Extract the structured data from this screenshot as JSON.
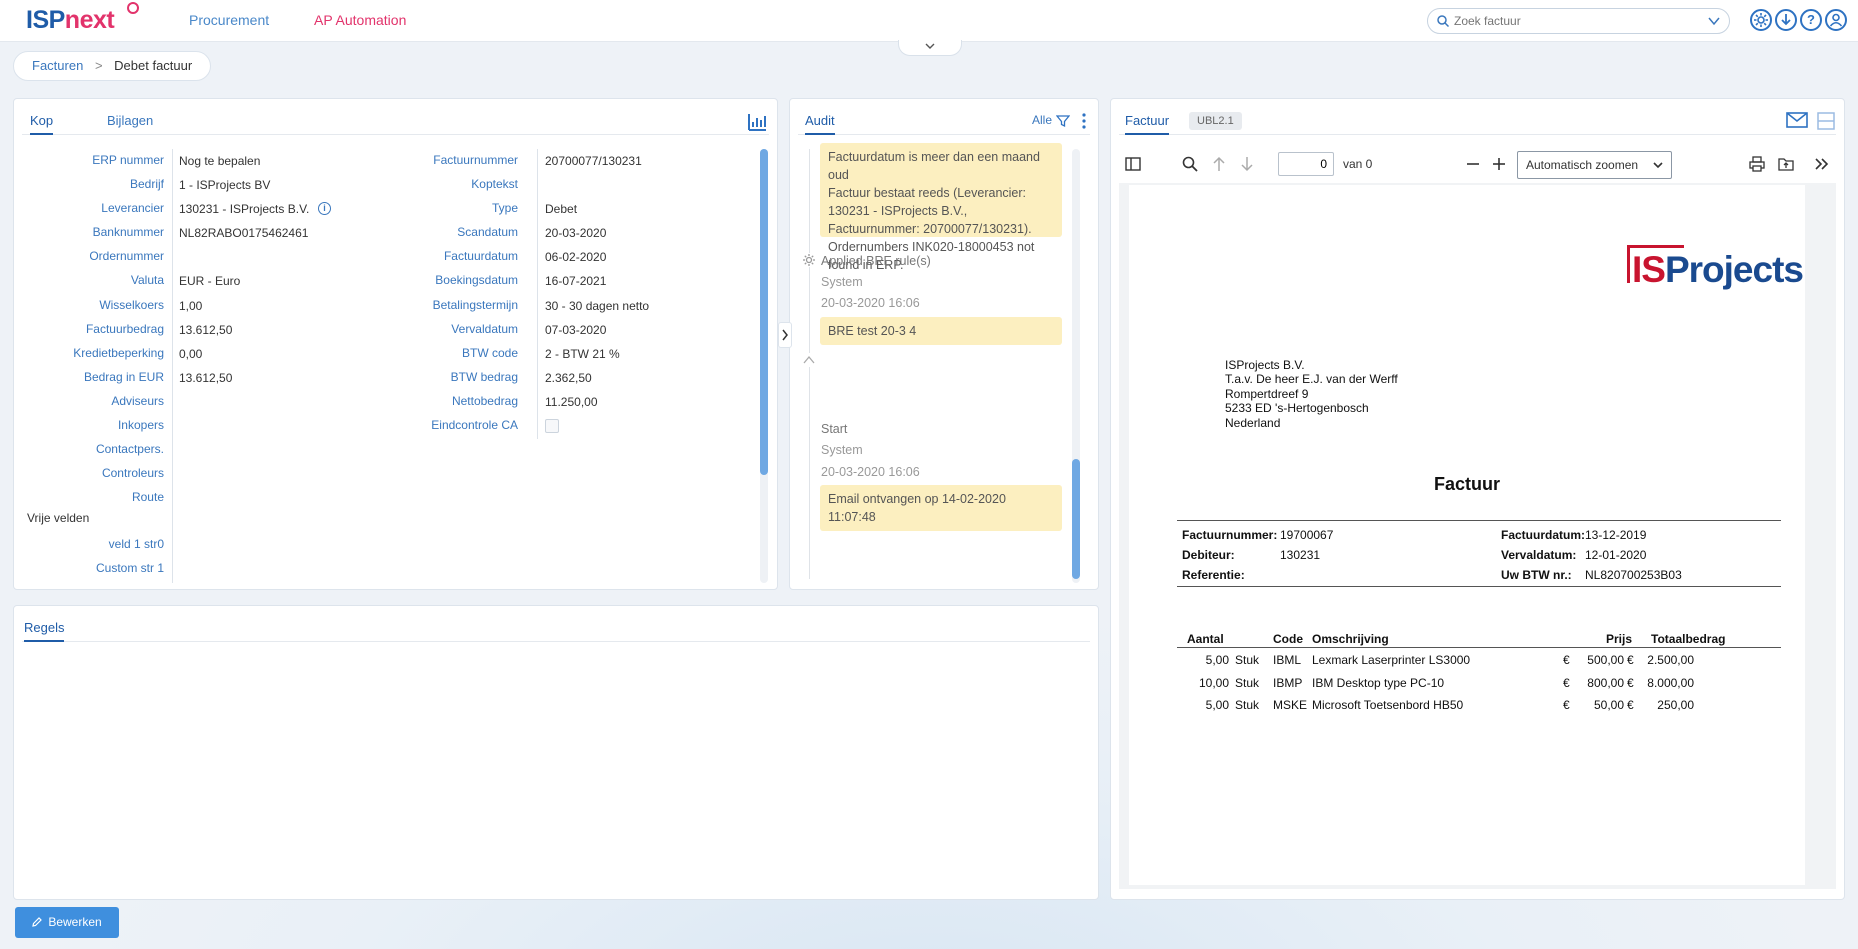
{
  "topbar": {
    "logo_part1": "ISP",
    "logo_part2": "next",
    "nav": [
      "Procurement",
      "AP Automation"
    ],
    "search_placeholder": "Zoek factuur",
    "icons": [
      "settings-icon",
      "download-icon",
      "help-icon",
      "user-icon"
    ]
  },
  "colors": {
    "brand_blue": "#1f5ca8",
    "brand_pink": "#e2336b",
    "accent": "#3f8fde",
    "note_yellow": "#fcefc0"
  },
  "breadcrumb": {
    "parent": "Facturen",
    "separator": ">",
    "current": "Debet factuur"
  },
  "kop": {
    "tabs": [
      "Kop",
      "Bijlagen"
    ],
    "left_fields": [
      {
        "label": "ERP nummer",
        "value": "Nog te bepalen"
      },
      {
        "label": "Bedrijf",
        "value": "1 - ISProjects BV"
      },
      {
        "label": "Leverancier",
        "value": "130231 - ISProjects B.V."
      },
      {
        "label": "Banknummer",
        "value": "NL82RABO0175462461"
      },
      {
        "label": "Ordernummer",
        "value": ""
      },
      {
        "label": "Valuta",
        "value": "EUR - Euro"
      },
      {
        "label": "Wisselkoers",
        "value": "1,00"
      },
      {
        "label": "Factuurbedrag",
        "value": "13.612,50"
      },
      {
        "label": "Kredietbeperking",
        "value": "0,00"
      },
      {
        "label": "Bedrag in EUR",
        "value": "13.612,50"
      },
      {
        "label": "Adviseurs",
        "value": ""
      },
      {
        "label": "Inkopers",
        "value": ""
      },
      {
        "label": "Contactpers.",
        "value": ""
      },
      {
        "label": "Controleurs",
        "value": ""
      },
      {
        "label": "Route",
        "value": ""
      }
    ],
    "right_fields": [
      {
        "label": "Factuurnummer",
        "value": "20700077/130231"
      },
      {
        "label": "Koptekst",
        "value": ""
      },
      {
        "label": "Type",
        "value": "Debet"
      },
      {
        "label": "Scandatum",
        "value": "20-03-2020"
      },
      {
        "label": "Factuurdatum",
        "value": "06-02-2020"
      },
      {
        "label": "Boekingsdatum",
        "value": "16-07-2021"
      },
      {
        "label": "Betalingstermijn",
        "value": "30 - 30 dagen netto"
      },
      {
        "label": "Vervaldatum",
        "value": "07-03-2020"
      },
      {
        "label": "BTW code",
        "value": "2 - BTW 21 %"
      },
      {
        "label": "BTW bedrag",
        "value": "2.362,50"
      },
      {
        "label": "Nettobedrag",
        "value": "11.250,00"
      },
      {
        "label": "Eindcontrole CA",
        "value": ""
      }
    ],
    "vrije_velden_title": "Vrije velden",
    "vrije_velden": [
      {
        "label": "veld 1 str0",
        "value": ""
      },
      {
        "label": "Custom str 1",
        "value": ""
      }
    ]
  },
  "audit": {
    "tab": "Audit",
    "filter_label": "Alle",
    "note1": "Factuurdatum is meer dan een maand oud\nFactuur bestaat reeds (Leverancier: 130231 - ISProjects B.V., Factuurnummer: 20700077/130231). Ordernumbers INK020-18000453 not found in ERP.",
    "entries": [
      {
        "title": "Applied BRE rule(s)",
        "user": "System",
        "time": "20-03-2020 16:06",
        "note": "BRE test 20-3 4"
      },
      {
        "title": "Start",
        "user": "System",
        "time": "20-03-2020 16:06",
        "note": "Email ontvangen op 14-02-2020 11:07:48"
      }
    ]
  },
  "factuur": {
    "tabs": [
      "Factuur",
      "UBL2.1"
    ],
    "page_number": "0",
    "page_of": "van 0",
    "zoom": "Automatisch zoomen",
    "invoice": {
      "logo": {
        "is": "IS",
        "rest": "Projects"
      },
      "address": [
        "ISProjects B.V.",
        "T.a.v. De heer E.J. van der Werff",
        "Rompertdreef 9",
        "5233 ED  's-Hertogenbosch",
        "Nederland"
      ],
      "title": "Factuur",
      "meta_left": [
        {
          "label": "Factuurnummer:",
          "value": "19700067"
        },
        {
          "label": "Debiteur:",
          "value": "130231"
        },
        {
          "label": "Referentie:",
          "value": ""
        }
      ],
      "meta_right": [
        {
          "label": "Factuurdatum:",
          "value": "13-12-2019"
        },
        {
          "label": "Vervaldatum:",
          "value": "12-01-2020"
        },
        {
          "label": "Uw BTW nr.:",
          "value": "NL820700253B03"
        }
      ],
      "columns": [
        "Aantal",
        "Code",
        "Omschrijving",
        "Prijs",
        "Totaalbedrag"
      ],
      "lines": [
        {
          "aantal": "5,00",
          "unit": "Stuk",
          "code": "IBML",
          "desc": "Lexmark Laserprinter LS3000",
          "cur1": "€",
          "prijs": "500,00",
          "cur2": "€",
          "totaal": "2.500,00"
        },
        {
          "aantal": "10,00",
          "unit": "Stuk",
          "code": "IBMP",
          "desc": "IBM Desktop type PC-10",
          "cur1": "€",
          "prijs": "800,00",
          "cur2": "€",
          "totaal": "8.000,00"
        },
        {
          "aantal": "5,00",
          "unit": "Stuk",
          "code": "MSKE",
          "desc": "Microsoft Toetsenbord HB50",
          "cur1": "€",
          "prijs": "50,00",
          "cur2": "€",
          "totaal": "250,00"
        }
      ]
    }
  },
  "regels": {
    "tab": "Regels"
  },
  "footer": {
    "edit_label": "Bewerken"
  }
}
